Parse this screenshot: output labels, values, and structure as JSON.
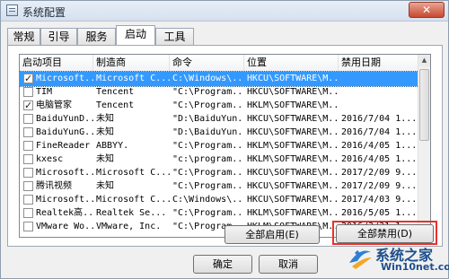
{
  "window": {
    "title": "系统配置",
    "close_label": "✕"
  },
  "tabs": [
    {
      "label": "常规",
      "active": false
    },
    {
      "label": "引导",
      "active": false
    },
    {
      "label": "服务",
      "active": false
    },
    {
      "label": "启动",
      "active": true
    },
    {
      "label": "工具",
      "active": false
    }
  ],
  "table": {
    "headers": [
      "启动项目",
      "制造商",
      "命令",
      "位置",
      "禁用日期"
    ],
    "rows": [
      {
        "checked": true,
        "item": "Microsoft...",
        "maker": "Microsoft C...",
        "command": "C:\\Windows\\...",
        "location": "HKCU\\SOFTWARE\\M...",
        "date": "",
        "selected": true
      },
      {
        "checked": false,
        "item": "TIM",
        "maker": "Tencent",
        "command": "\"C:\\Program...",
        "location": "HKCU\\SOFTWARE\\M...",
        "date": ""
      },
      {
        "checked": true,
        "item": "电脑管家",
        "maker": "Tencent",
        "command": "\"C:\\Program...",
        "location": "HKLM\\SOFTWARE\\M...",
        "date": ""
      },
      {
        "checked": false,
        "item": "BaiduYunD...",
        "maker": "未知",
        "command": "\"D:\\BaiduYun...",
        "location": "HKCU\\SOFTWARE\\M...",
        "date": "2016/7/04 1..."
      },
      {
        "checked": false,
        "item": "BaiduYunG...",
        "maker": "未知",
        "command": "\"D:\\BaiduYun...",
        "location": "HKCU\\SOFTWARE\\M...",
        "date": "2016/7/04 1..."
      },
      {
        "checked": false,
        "item": "FineReader",
        "maker": "ABBYY.",
        "command": "\"C:\\Program...",
        "location": "HKLM\\SOFTWARE\\M...",
        "date": "2016/4/05 1..."
      },
      {
        "checked": false,
        "item": "kxesc",
        "maker": "未知",
        "command": "\"c:\\program...",
        "location": "HKLM\\SOFTWARE\\M...",
        "date": "2016/4/05 1..."
      },
      {
        "checked": false,
        "item": "Microsoft...",
        "maker": "Microsoft C...",
        "command": "\"C:\\Program...",
        "location": "HKCU\\SOFTWARE\\M...",
        "date": "2017/2/09 9..."
      },
      {
        "checked": false,
        "item": "腾讯视频",
        "maker": "未知",
        "command": "\"C:\\Program...",
        "location": "HKCU\\SOFTWARE\\M...",
        "date": "2017/2/09 9..."
      },
      {
        "checked": false,
        "item": "Microsoft...",
        "maker": "Microsoft C...",
        "command": "C:\\Windows\\...",
        "location": "HKCU\\SOFTWARE\\M...",
        "date": "2017/4/03 9..."
      },
      {
        "checked": false,
        "item": "Realtek高...",
        "maker": "Realtek Se...",
        "command": "\"C:\\Program...",
        "location": "HKLM\\SOFTWARE\\M...",
        "date": "2016/5/05 1..."
      },
      {
        "checked": false,
        "item": "VMware Wo...",
        "maker": "VMware, Inc.",
        "command": "\"C:\\Program...",
        "location": "HKLM\\SOFTWARE\\M...",
        "date": "2016/3/31 1..."
      }
    ]
  },
  "buttons": {
    "enable_all": "全部启用(E)",
    "disable_all": "全部禁用(D)",
    "ok": "确定",
    "cancel": "取消"
  },
  "watermark": {
    "line1": "系统之家",
    "line2": "Win10net.com"
  },
  "colors": {
    "selection": "#3399ff",
    "highlight_box": "#e8312a",
    "watermark": "#1d4f8c"
  }
}
